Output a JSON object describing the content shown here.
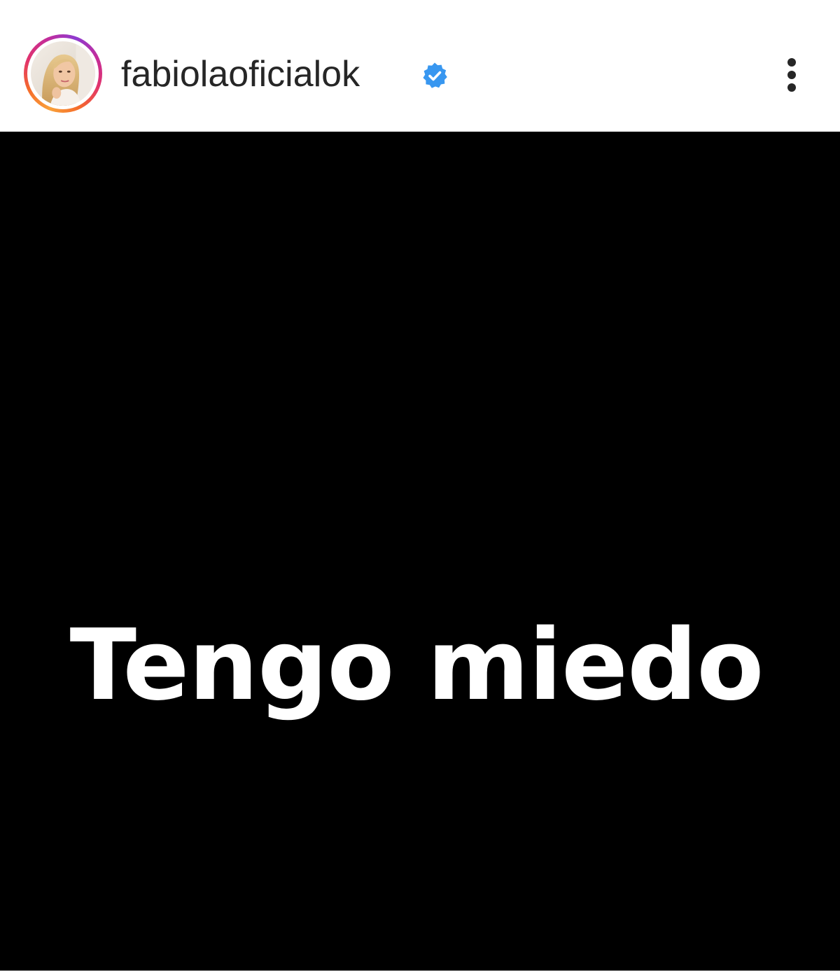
{
  "header": {
    "username": "fabiolaoficialok",
    "verified": true,
    "verified_color": "#3897f0",
    "avatar_ring_colors": [
      "#f9a13a",
      "#e2336b",
      "#8e3ad0"
    ],
    "more_icon": "more-vertical-icon"
  },
  "media": {
    "background_color": "#000000",
    "text": "Tengo miedo",
    "text_color": "#ffffff"
  }
}
